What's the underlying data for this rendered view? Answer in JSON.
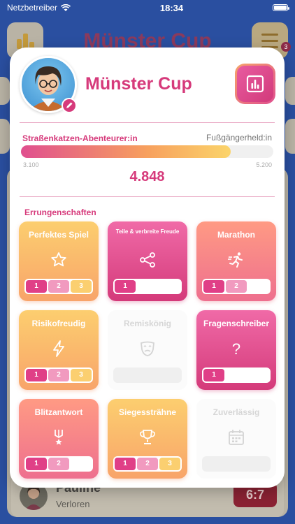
{
  "status_bar": {
    "carrier": "Netzbetreiber",
    "time": "18:34"
  },
  "background": {
    "title": "Münster Cup",
    "badge": "3",
    "player_name": "Pauline",
    "player_status": "Verloren",
    "score": "6:7"
  },
  "modal": {
    "title": "Münster Cup",
    "rank_current": "Straßenkatzen-Abenteurer:in",
    "rank_next": "Fußgängerheld:in",
    "progress_percent": 83,
    "range_min": "3.100",
    "range_max": "5.200",
    "points": "4.848",
    "section_title": "Errungenschaften",
    "colors": {
      "accent": "#d63a7b",
      "orange": "#f8a46a",
      "pink": "#d43a7a"
    },
    "achievements": [
      {
        "title": "Perfektes Spiel",
        "icon": "star-icon",
        "style": "orange",
        "levels": [
          "1",
          "2",
          "3"
        ]
      },
      {
        "title": "Teile & verbreite Freude",
        "icon": "share-icon",
        "style": "pink",
        "levels": [
          "1"
        ]
      },
      {
        "title": "Marathon",
        "icon": "runner-icon",
        "style": "coral",
        "levels": [
          "1",
          "2"
        ]
      },
      {
        "title": "Risikofreudig",
        "icon": "lightning-icon",
        "style": "orange",
        "levels": [
          "1",
          "2",
          "3"
        ]
      },
      {
        "title": "Remiskönig",
        "icon": "mask-icon",
        "style": "disabled",
        "levels": []
      },
      {
        "title": "Fragenschreiber",
        "icon": "question-icon",
        "style": "pink",
        "levels": [
          "1"
        ]
      },
      {
        "title": "Blitzantwort",
        "icon": "medal-icon",
        "style": "coral",
        "levels": [
          "1",
          "2"
        ]
      },
      {
        "title": "Siegessträhne",
        "icon": "trophy-icon",
        "style": "orange",
        "levels": [
          "1",
          "2",
          "3"
        ]
      },
      {
        "title": "Zuverlässig",
        "icon": "calendar-icon",
        "style": "disabled",
        "levels": []
      }
    ]
  }
}
